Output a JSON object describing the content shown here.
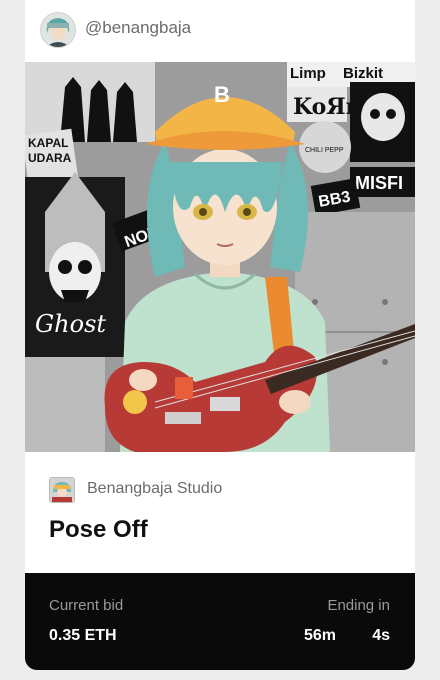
{
  "owner": {
    "handle": "@benangbaja"
  },
  "artwork": {
    "sign_texts": [
      "Limp",
      "Bizkit",
      "KoЯn",
      "KAPAL",
      "UDARA",
      "NOFX",
      "BB3",
      "MISFI",
      "Ghost",
      "CHILI PEPP"
    ],
    "cap_letter": "B"
  },
  "studio": {
    "name": "Benangbaja Studio"
  },
  "item": {
    "title": "Pose Off"
  },
  "auction": {
    "current_bid_label": "Current bid",
    "current_bid_value": "0.35 ETH",
    "ending_label": "Ending in",
    "minutes": "56m",
    "seconds": "4s"
  }
}
